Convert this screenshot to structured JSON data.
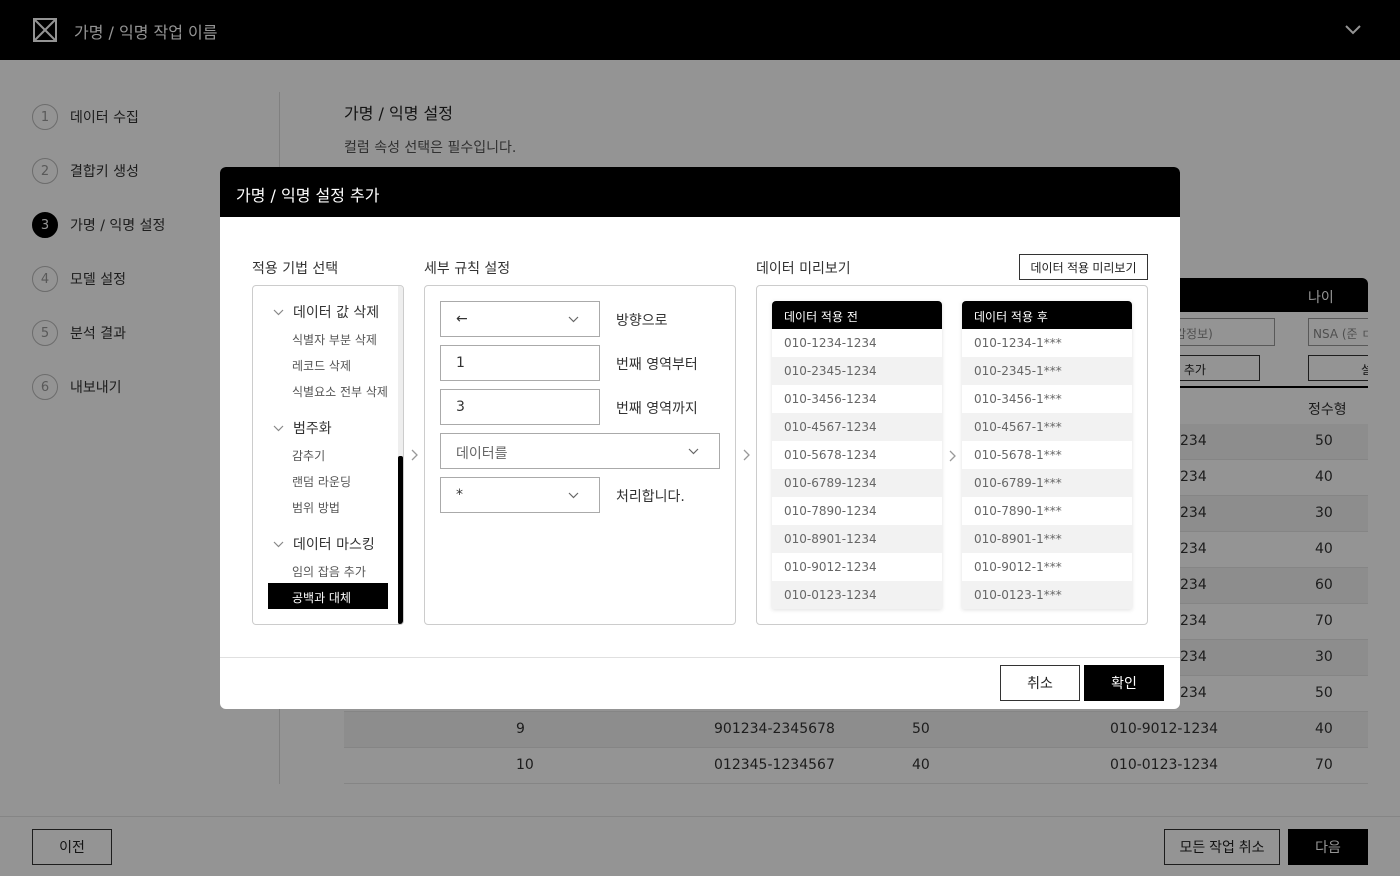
{
  "header": {
    "title": "가명 / 익명 작업 이름"
  },
  "steps": [
    {
      "num": "1",
      "label": "데이터 수집"
    },
    {
      "num": "2",
      "label": "결합키 생성"
    },
    {
      "num": "3",
      "label": "가명 / 익명 설정",
      "active": true
    },
    {
      "num": "4",
      "label": "모델 설정"
    },
    {
      "num": "5",
      "label": "분석 결과"
    },
    {
      "num": "6",
      "label": "내보내기"
    }
  ],
  "main": {
    "title": "가명 / 익명 설정",
    "description": "컬럼 속성 선택은 필수입니다."
  },
  "bg_table": {
    "header_age": "나이",
    "select_left": "감정보)",
    "select_right": "NSA (준 ㄷ",
    "button_left": "ㅣ 추가",
    "button_right": "설",
    "subhead_type": "정수형",
    "rows": [
      {
        "c4": "234",
        "age": "50"
      },
      {
        "c4": "234",
        "age": "40"
      },
      {
        "c4": "234",
        "age": "30"
      },
      {
        "c4": "234",
        "age": "40"
      },
      {
        "c4": "234",
        "age": "60"
      },
      {
        "c4": "234",
        "age": "70"
      },
      {
        "c4": "234",
        "age": "30"
      },
      {
        "c4": "234",
        "age": "50"
      },
      {
        "idx": "9",
        "id": "901234-2345678",
        "v": "50",
        "phone": "010-9012-1234",
        "age": "40"
      },
      {
        "idx": "10",
        "id": "012345-1234567",
        "v": "40",
        "phone": "010-0123-1234",
        "age": "70"
      }
    ]
  },
  "footer": {
    "prev": "이전",
    "cancel_all": "모든 작업 취소",
    "next": "다음"
  },
  "modal": {
    "title": "가명 / 익명 설정 추가",
    "technique_title": "적용 기법 선택",
    "rule_title": "세부 규칙 설정",
    "preview_title": "데이터 미리보기",
    "preview_button": "데이터 적용 미리보기",
    "categories": [
      {
        "label": "데이터 값 삭제",
        "items": [
          "식별자 부분 삭제",
          "레코드 삭제",
          "식별요소 전부 삭제"
        ]
      },
      {
        "label": "범주화",
        "items": [
          "감추기",
          "랜덤 라운딩",
          "범위 방법"
        ]
      },
      {
        "label": "데이터 마스킹",
        "items": [
          "임의 잡음 추가",
          "공백과 대체"
        ]
      }
    ],
    "selected_item": "공백과 대체",
    "rule": {
      "direction_value": "←",
      "direction_label": "방향으로",
      "from_value": "1",
      "from_label": "번째 영역부터",
      "to_value": "3",
      "to_label": "번째 영역까지",
      "target_value": "데이터를",
      "char_value": "*",
      "char_label": "처리합니다."
    },
    "preview": {
      "before_header": "데이터 적용 전",
      "after_header": "데이터 적용 후",
      "before": [
        "010-1234-1234",
        "010-2345-1234",
        "010-3456-1234",
        "010-4567-1234",
        "010-5678-1234",
        "010-6789-1234",
        "010-7890-1234",
        "010-8901-1234",
        "010-9012-1234",
        "010-0123-1234"
      ],
      "after": [
        "010-1234-1***",
        "010-2345-1***",
        "010-3456-1***",
        "010-4567-1***",
        "010-5678-1***",
        "010-6789-1***",
        "010-7890-1***",
        "010-8901-1***",
        "010-9012-1***",
        "010-0123-1***"
      ]
    },
    "cancel": "취소",
    "ok": "확인"
  },
  "icons": {
    "logo": "logo-x-icon",
    "header_chevron": "chevron-down-icon",
    "category_chevron": "chevron-down-icon",
    "separator": "chevron-right-icon"
  }
}
